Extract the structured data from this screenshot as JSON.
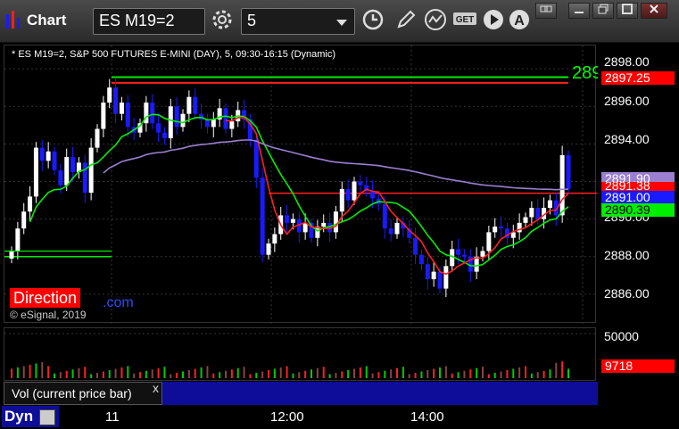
{
  "toolbar": {
    "title": "Chart",
    "symbol": "ES M19=2",
    "interval": "5"
  },
  "chart": {
    "header": "* ES M19=2, S&P 500 FUTURES E-MINI (DAY), 5, 09:30-16:15 (Dynamic)",
    "direction_label": "Direction",
    "direction_suffix": ".com",
    "copyright": "© eSignal, 2019",
    "corner_text": "289"
  },
  "price_axis": {
    "ticks": [
      "2898.00",
      "2896.00",
      "2894.00",
      "2890.00",
      "2888.00",
      "2886.00"
    ],
    "tags": [
      {
        "label": "2897.25",
        "bg": "#ff0000",
        "fg": "#ffffff"
      },
      {
        "label": "2891.90",
        "bg": "#9c7fcf",
        "fg": "#ffffff"
      },
      {
        "label": "2891.38",
        "bg": "#ff0000",
        "fg": "#ffffff"
      },
      {
        "label": "2891.00",
        "bg": "#1a1aff",
        "fg": "#ffffff"
      },
      {
        "label": "2890.39",
        "bg": "#00ee00",
        "fg": "#000000"
      }
    ]
  },
  "volume_axis": {
    "ticks": [
      "50000"
    ],
    "current": "9718"
  },
  "study": {
    "label": "Vol (current price bar)",
    "close_label": "x"
  },
  "x_axis": {
    "mode": "Dyn",
    "ticks": [
      "11",
      "12:00",
      "14:00"
    ]
  },
  "colors": {
    "up": "#ffffff",
    "down": "#1a1aff",
    "ma_fast": "#ff2020",
    "ma_slow": "#00ee00",
    "vwap": "#9c7fcf"
  },
  "chart_data": {
    "type": "candlestick",
    "title": "* ES M19=2, S&P 500 FUTURES E-MINI (DAY), 5, 09:30-16:15 (Dynamic)",
    "ylim": [
      2885.0,
      2899.0
    ],
    "closes": [
      2888.3,
      2889.5,
      2890.4,
      2891.2,
      2893.8,
      2893.1,
      2893.6,
      2892.6,
      2891.8,
      2893.3,
      2892.5,
      2893.0,
      2891.4,
      2893.8,
      2894.8,
      2896.2,
      2897.0,
      2895.6,
      2896.2,
      2894.9,
      2894.6,
      2895.1,
      2896.2,
      2895.1,
      2894.6,
      2894.3,
      2896.0,
      2894.9,
      2895.6,
      2896.5,
      2895.6,
      2895.3,
      2894.9,
      2895.3,
      2895.9,
      2894.8,
      2895.2,
      2895.8,
      2895.3,
      2894.2,
      2892.2,
      2888.1,
      2888.7,
      2889.2,
      2890.2,
      2889.8,
      2890.0,
      2889.3,
      2889.8,
      2889.0,
      2889.6,
      2889.8,
      2889.3,
      2890.4,
      2891.6,
      2891.0,
      2892.0,
      2891.8,
      2891.5,
      2891.1,
      2890.8,
      2889.5,
      2889.2,
      2889.8,
      2889.5,
      2889.0,
      2888.1,
      2887.6,
      2886.8,
      2887.2,
      2886.3,
      2887.5,
      2888.4,
      2888.1,
      2888.0,
      2887.2,
      2888.0,
      2888.3,
      2889.3,
      2889.6,
      2889.5,
      2889.0,
      2889.3,
      2889.8,
      2890.1,
      2890.6,
      2890.0,
      2890.6,
      2891.0,
      2890.2,
      2893.4,
      2891.6
    ],
    "volume_max": 50000,
    "current_volume": 9718,
    "x_ticks": [
      "11",
      "12:00",
      "14:00"
    ]
  }
}
